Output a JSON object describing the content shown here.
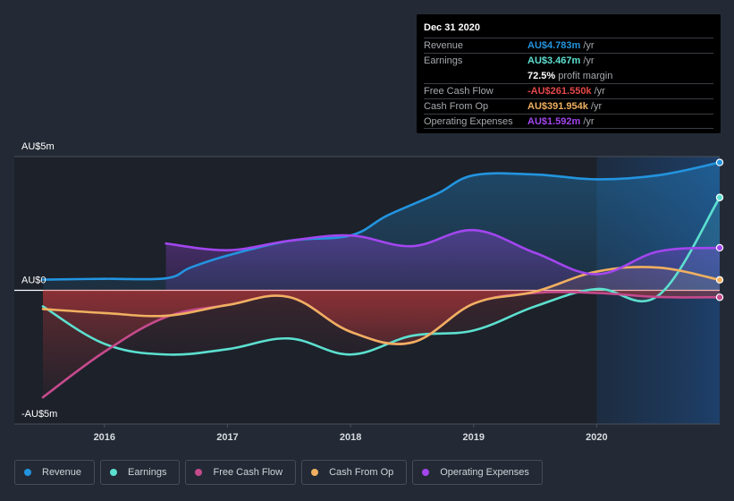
{
  "tooltip": {
    "date": "Dec 31 2020",
    "rows": [
      {
        "label": "Revenue",
        "value": "AU$4.783m",
        "unit": "/yr",
        "color": "#2394df"
      },
      {
        "label": "Earnings",
        "value": "AU$3.467m",
        "unit": "/yr",
        "color": "#5ce0d0"
      },
      {
        "label": "",
        "value": "72.5%",
        "unit": "profit margin",
        "color": "#ffffff"
      },
      {
        "label": "Free Cash Flow",
        "value": "-AU$261.550k",
        "unit": "/yr",
        "color": "#e64848"
      },
      {
        "label": "Cash From Op",
        "value": "AU$391.954k",
        "unit": "/yr",
        "color": "#f0b060"
      },
      {
        "label": "Operating Expenses",
        "value": "AU$1.592m",
        "unit": "/yr",
        "color": "#a246ee"
      }
    ]
  },
  "legend": [
    {
      "label": "Revenue",
      "color": "#2394df"
    },
    {
      "label": "Earnings",
      "color": "#5ce0d0"
    },
    {
      "label": "Free Cash Flow",
      "color": "#c54a8c"
    },
    {
      "label": "Cash From Op",
      "color": "#f0b060"
    },
    {
      "label": "Operating Expenses",
      "color": "#a246ee"
    }
  ],
  "chart_data": {
    "type": "line",
    "title": "",
    "xlabel": "",
    "ylabel": "",
    "currency": "AUD",
    "y_unit": "AU$ millions",
    "ylim": [
      -5,
      5
    ],
    "xlim": [
      2015.5,
      2021.0
    ],
    "y_ticks": [
      {
        "value": 5,
        "label": "AU$5m"
      },
      {
        "value": 0,
        "label": "AU$0"
      },
      {
        "value": -5,
        "label": "-AU$5m"
      }
    ],
    "x_ticks": [
      {
        "value": 2016,
        "label": "2016"
      },
      {
        "value": 2017,
        "label": "2017"
      },
      {
        "value": 2018,
        "label": "2018"
      },
      {
        "value": 2019,
        "label": "2019"
      },
      {
        "value": 2020,
        "label": "2020"
      }
    ],
    "highlight_region": [
      2020.0,
      2021.0
    ],
    "legend_position": "bottom",
    "series": [
      {
        "name": "Revenue",
        "color": "#2394df",
        "points": [
          [
            2015.5,
            0.4
          ],
          [
            2016.0,
            0.43
          ],
          [
            2016.5,
            0.45
          ],
          [
            2016.7,
            0.85
          ],
          [
            2017.0,
            1.3
          ],
          [
            2017.5,
            1.85
          ],
          [
            2018.0,
            2.05
          ],
          [
            2018.3,
            2.8
          ],
          [
            2018.7,
            3.6
          ],
          [
            2019.0,
            4.3
          ],
          [
            2019.5,
            4.33
          ],
          [
            2020.0,
            4.15
          ],
          [
            2020.5,
            4.3
          ],
          [
            2021.0,
            4.78
          ]
        ]
      },
      {
        "name": "Earnings",
        "color": "#5ce0d0",
        "points": [
          [
            2015.5,
            -0.6
          ],
          [
            2016.0,
            -2.0
          ],
          [
            2016.5,
            -2.4
          ],
          [
            2017.0,
            -2.2
          ],
          [
            2017.5,
            -1.8
          ],
          [
            2018.0,
            -2.4
          ],
          [
            2018.5,
            -1.7
          ],
          [
            2019.0,
            -1.5
          ],
          [
            2019.5,
            -0.6
          ],
          [
            2020.0,
            0.05
          ],
          [
            2020.5,
            -0.2
          ],
          [
            2021.0,
            3.47
          ]
        ]
      },
      {
        "name": "Free Cash Flow",
        "color": "#c54a8c",
        "points": [
          [
            2015.5,
            -4.0
          ],
          [
            2016.0,
            -2.3
          ],
          [
            2016.5,
            -1.0
          ],
          [
            2017.0,
            -0.55
          ],
          [
            2017.5,
            -0.25
          ],
          [
            2018.0,
            -1.55
          ],
          [
            2018.5,
            -1.95
          ],
          [
            2019.0,
            -0.5
          ],
          [
            2019.5,
            -0.1
          ],
          [
            2020.0,
            -0.1
          ],
          [
            2020.5,
            -0.25
          ],
          [
            2021.0,
            -0.26
          ]
        ]
      },
      {
        "name": "Cash From Op",
        "color": "#f0b060",
        "points": [
          [
            2015.5,
            -0.7
          ],
          [
            2016.0,
            -0.85
          ],
          [
            2016.5,
            -0.95
          ],
          [
            2017.0,
            -0.55
          ],
          [
            2017.5,
            -0.25
          ],
          [
            2018.0,
            -1.55
          ],
          [
            2018.5,
            -1.95
          ],
          [
            2019.0,
            -0.5
          ],
          [
            2019.5,
            -0.05
          ],
          [
            2020.0,
            0.7
          ],
          [
            2020.5,
            0.85
          ],
          [
            2021.0,
            0.39
          ]
        ]
      },
      {
        "name": "Operating Expenses",
        "color": "#a246ee",
        "points": [
          [
            2016.5,
            1.75
          ],
          [
            2017.0,
            1.5
          ],
          [
            2017.5,
            1.85
          ],
          [
            2018.0,
            2.05
          ],
          [
            2018.5,
            1.65
          ],
          [
            2019.0,
            2.25
          ],
          [
            2019.5,
            1.4
          ],
          [
            2020.0,
            0.6
          ],
          [
            2020.5,
            1.45
          ],
          [
            2021.0,
            1.59
          ]
        ]
      }
    ]
  }
}
